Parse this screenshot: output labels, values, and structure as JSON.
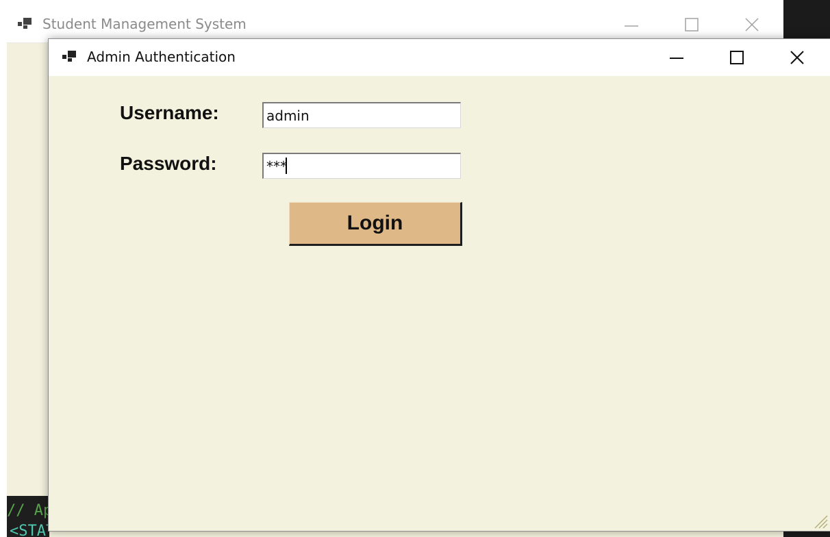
{
  "main_window": {
    "title": "Student Management System",
    "controls": [
      "minimize-icon",
      "maximize-icon",
      "close-icon"
    ]
  },
  "console": {
    "line1": "// Ap",
    "line2": "<STAThread>]"
  },
  "dialog": {
    "title": "Admin Authentication",
    "username_label": "Username:",
    "username_value": "admin",
    "password_label": "Password:",
    "password_value": "***",
    "login_label": "Login"
  },
  "colors": {
    "dialog_background": "#f3f2de",
    "login_button": "#deb887"
  }
}
